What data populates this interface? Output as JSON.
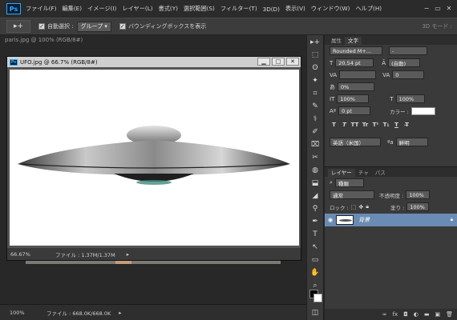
{
  "app": {
    "logo": "Ps"
  },
  "menu": [
    "ファイル(F)",
    "編集(E)",
    "イメージ(I)",
    "レイヤー(L)",
    "書式(Y)",
    "選択範囲(S)",
    "フィルター(T)",
    "3D(D)",
    "表示(V)",
    "ウィンドウ(W)",
    "ヘルプ(H)"
  ],
  "window_controls": {
    "minimize": "−",
    "restore": "▭",
    "close": "✕"
  },
  "options": {
    "tool_icon": "▸+",
    "auto_select_label": "自動選択 :",
    "auto_select_value": "グループ",
    "bounding_box_label": "バウンディングボックスを表示",
    "mode_label": "3D モード :"
  },
  "background_doc": {
    "tab": "paris.jpg @ 100% (RGB/8#)"
  },
  "ufo_doc": {
    "title": "UFO.jpg @ 66.7% (RGB/8#)",
    "zoom": "66.67%",
    "file_info": "ファイル : 1.37M/1.37M",
    "buttons": {
      "minimize": "▁",
      "restore": "□",
      "close": "✕"
    }
  },
  "statusbar": {
    "zoom": "100%",
    "file_info": "ファイル : 668.0K/668.0K"
  },
  "tools": [
    "▸+",
    "⬚",
    "ʘ",
    "✦",
    "⌗",
    "✎",
    "⚕",
    "✐",
    "⌧",
    "✂",
    "◍",
    "⬓",
    "◢",
    "⚲",
    "✒",
    "T",
    "↖",
    "▭",
    "✋",
    "⌕",
    "◫"
  ],
  "char_panel": {
    "tabs": [
      "属性",
      "文字"
    ],
    "font_family": "Rounded M+...",
    "font_style": "-",
    "font_size": "20.54 pt",
    "leading": "(自動)",
    "kerning": "",
    "tracking": "0",
    "tsume": "0%",
    "vscale": "100%",
    "hscale": "100%",
    "baseline": "0 pt",
    "color_label": "カラー :",
    "format_buttons": [
      "T",
      "T",
      "TT",
      "Tr",
      "T¹",
      "T₁",
      "T",
      "T̶"
    ],
    "language": "英語（米国）",
    "antialias": "鮮明",
    "aa_prefix": "ªa"
  },
  "layers_panel": {
    "tabs": [
      "レイヤー",
      "チャ",
      "パス"
    ],
    "kind_label": "種類",
    "blend_mode": "通常",
    "opacity_label": "不透明度 :",
    "opacity_value": "100%",
    "lock_label": "ロック :",
    "fill_label": "塗り :",
    "fill_value": "100%",
    "layer_name": "背景"
  },
  "colors": {
    "accent": "#31a8ff",
    "panel": "#3a3a3a",
    "selected_layer": "#6a8bb3"
  }
}
